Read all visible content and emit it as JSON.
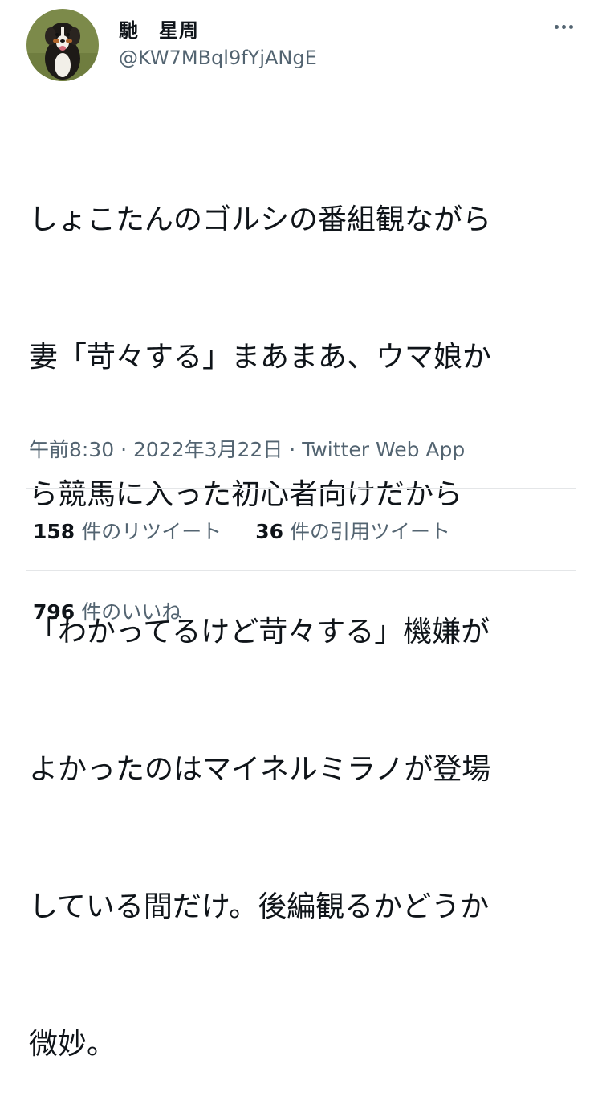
{
  "user": {
    "display_name": "馳　星周",
    "handle": "@KW7MBql9fYjANgE",
    "avatar": "bernese-mountain-dog-photo"
  },
  "menu": {
    "icon": "more-dots-icon"
  },
  "tweet": {
    "lines": [
      "しょこたんのゴルシの番組観ながら",
      "妻「苛々する」まあまあ、ウマ娘か",
      "ら競馬に入った初心者向けだから",
      "「わかってるけど苛々する」機嫌が",
      "よかったのはマイネルミラノが登場",
      "している間だけ。後編観るかどうか",
      "微妙。"
    ]
  },
  "meta": {
    "time": "午前8:30",
    "date": "2022年3月22日",
    "source": "Twitter Web App",
    "separator": "·"
  },
  "stats": {
    "retweets": {
      "count": "158",
      "label": "件のリツイート"
    },
    "quotes": {
      "count": "36",
      "label": "件の引用ツイート"
    },
    "likes": {
      "count": "796",
      "label": "件のいいね"
    }
  },
  "colors": {
    "text": "#0f1419",
    "secondary": "#536471",
    "divider": "#e4e6e8"
  }
}
